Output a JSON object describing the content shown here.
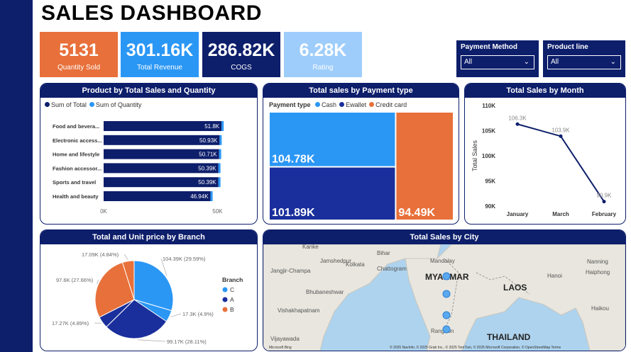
{
  "title": "SALES DASHBOARD",
  "kpis": [
    {
      "value": "5131",
      "label": "Quantity Sold",
      "color": "#e8703a"
    },
    {
      "value": "301.16K",
      "label": "Total Revenue",
      "color": "#2b97f5"
    },
    {
      "value": "286.82K",
      "label": "COGS",
      "color": "#0d1e6b"
    },
    {
      "value": "6.28K",
      "label": "Rating",
      "color": "#9ecdfb"
    }
  ],
  "slicers": {
    "payment": {
      "label": "Payment Method",
      "value": "All"
    },
    "product": {
      "label": "Product line",
      "value": "All"
    }
  },
  "colors": {
    "navy": "#0d1e6b",
    "blue": "#2b97f5",
    "royal": "#1a2f9c",
    "orange": "#e8703a",
    "light": "#9ecdfb"
  },
  "chart_data": [
    {
      "type": "bar",
      "title": "Product by Total Sales and Quantity",
      "legend": [
        "Sum of Total",
        "Sum of Quantity"
      ],
      "categories": [
        "Food and bevera...",
        "Electronic access...",
        "Home and lifestyle",
        "Fashion accessor...",
        "Sports and travel",
        "Health and beauty"
      ],
      "series": [
        {
          "name": "Sum of Total",
          "values": [
            51.8,
            50.93,
            50.71,
            50.39,
            50.39,
            46.94
          ]
        }
      ],
      "data_labels": [
        "51.8K",
        "50.93K",
        "50.71K",
        "50.39K",
        "50.39K",
        "46.94K"
      ],
      "x_ticks": [
        "0K",
        "50K"
      ],
      "xlim": [
        0,
        53
      ]
    },
    {
      "type": "treemap",
      "title": "Total sales by Payment type",
      "legend_title": "Payment type",
      "categories": [
        "Cash",
        "Ewallet",
        "Credit card"
      ],
      "values": [
        104.78,
        101.89,
        94.49
      ],
      "labels": [
        "104.78K",
        "101.89K",
        "94.49K"
      ]
    },
    {
      "type": "line",
      "title": "Total Sales by Month",
      "ylabel": "Total Sales",
      "categories": [
        "January",
        "March",
        "February"
      ],
      "values": [
        106.3,
        103.9,
        90.9
      ],
      "data_labels": [
        "106.3K",
        "103.9K",
        "90.9K"
      ],
      "y_ticks": [
        "110K",
        "105K",
        "100K",
        "95K",
        "90K"
      ],
      "ylim": [
        90,
        110
      ]
    },
    {
      "type": "pie",
      "title": "Total and Unit price by Branch",
      "legend_title": "Branch",
      "legend": [
        "C",
        "A",
        "B"
      ],
      "slices": [
        {
          "label": "104.39K (29.59%)",
          "value": 29.59,
          "color": "#2b97f5"
        },
        {
          "label": "17.3K (4.9%)",
          "value": 4.9,
          "color": "#2b97f5"
        },
        {
          "label": "99.17K (28.11%)",
          "value": 28.11,
          "color": "#1a2f9c"
        },
        {
          "label": "17.27K (4.89%)",
          "value": 4.89,
          "color": "#1a2f9c"
        },
        {
          "label": "97.6K (27.66%)",
          "value": 27.66,
          "color": "#e8703a"
        },
        {
          "label": "17.09K (4.84%)",
          "value": 4.84,
          "color": "#e8703a"
        }
      ]
    },
    {
      "type": "map",
      "title": "Total Sales by City",
      "place_labels": [
        "Kanke",
        "Bihar",
        "Jamshedpur",
        "Kolkata",
        "Chattogram",
        "Jangjir-Champa",
        "Bhubaneshwar",
        "Vishakhapatnam",
        "Mandalay",
        "MYANMAR",
        "LAOS",
        "THAILAND",
        "Rangoon",
        "Nanning",
        "Haiphong",
        "Hanoi",
        "Haikou",
        "Vijayawada"
      ],
      "attribution": "© 2025 NavInfo, © 2025 Grab Inc., © 2025 TomTom, © 2025 Microsoft Corporation, © OpenStreetMap  Terms",
      "logo": "Microsoft Bing"
    }
  ]
}
